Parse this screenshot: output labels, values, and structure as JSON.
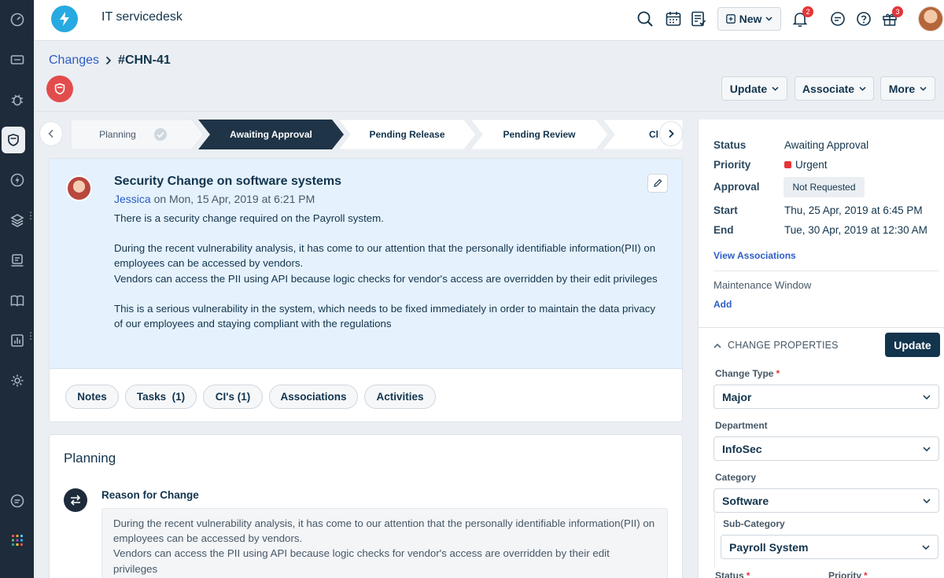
{
  "app": {
    "title": "IT servicedesk"
  },
  "topbar": {
    "new_label": "New",
    "notifications_count": "2",
    "gift_count": "3"
  },
  "breadcrumb": {
    "parent": "Changes",
    "current": "#CHN-41"
  },
  "header_actions": {
    "update": "Update",
    "associate": "Associate",
    "more": "More"
  },
  "stepper": {
    "steps": [
      {
        "label": "Planning",
        "state": "done"
      },
      {
        "label": "Awaiting Approval",
        "state": "active"
      },
      {
        "label": "Pending Release",
        "state": "upcoming"
      },
      {
        "label": "Pending Review",
        "state": "upcoming"
      },
      {
        "label": "Cl",
        "state": "upcoming"
      }
    ]
  },
  "description": {
    "title": "Security Change on software systems",
    "author": "Jessica",
    "meta_rest": "on Mon, 15 Apr, 2019 at 6:21 PM",
    "paragraphs": [
      "There is a security change required on the Payroll system.",
      "During the recent vulnerability analysis, it has come to our attention that the personally identifiable information(PII) on employees can be accessed by vendors.\nVendors can access the PII using API because logic checks for vendor's access are overridden by their edit privileges",
      "This is a serious vulnerability in the system, which needs to be fixed immediately in order to maintain the data privacy of our employees and staying compliant with the regulations"
    ]
  },
  "tabs": {
    "notes": "Notes",
    "tasks": "Tasks  (1)",
    "cis": "CI's (1)",
    "associations": "Associations",
    "activities": "Activities"
  },
  "planning": {
    "title": "Planning",
    "reason_label": "Reason for Change",
    "reason_text": "During the recent vulnerability analysis, it has come to our attention that the personally identifiable information(PII) on employees can be accessed by vendors.\nVendors can access the PII using API because logic checks for vendor's access are overridden by their edit privileges"
  },
  "summary": {
    "status_label": "Status",
    "status_value": "Awaiting Approval",
    "priority_label": "Priority",
    "priority_value": "Urgent",
    "approval_label": "Approval",
    "approval_value": "Not Requested",
    "start_label": "Start",
    "start_value": "Thu, 25 Apr, 2019 at 6:45 PM",
    "end_label": "End",
    "end_value": "Tue, 30 Apr, 2019 at 12:30 AM",
    "view_associations": "View Associations",
    "maintenance_label": "Maintenance Window",
    "maintenance_add": "Add"
  },
  "properties": {
    "heading": "CHANGE PROPERTIES",
    "update_label": "Update",
    "change_type_label": "Change Type",
    "change_type_value": "Major",
    "department_label": "Department",
    "department_value": "InfoSec",
    "category_label": "Category",
    "category_value": "Software",
    "subcategory_label": "Sub-Category",
    "subcategory_value": "Payroll System",
    "status_label": "Status",
    "priority_label": "Priority"
  },
  "colors": {
    "accent": "#2c5cc5",
    "rail": "#1d2b3b",
    "active_step": "#1f3447",
    "urgent": "#e43538",
    "primary_button": "#12344d"
  }
}
